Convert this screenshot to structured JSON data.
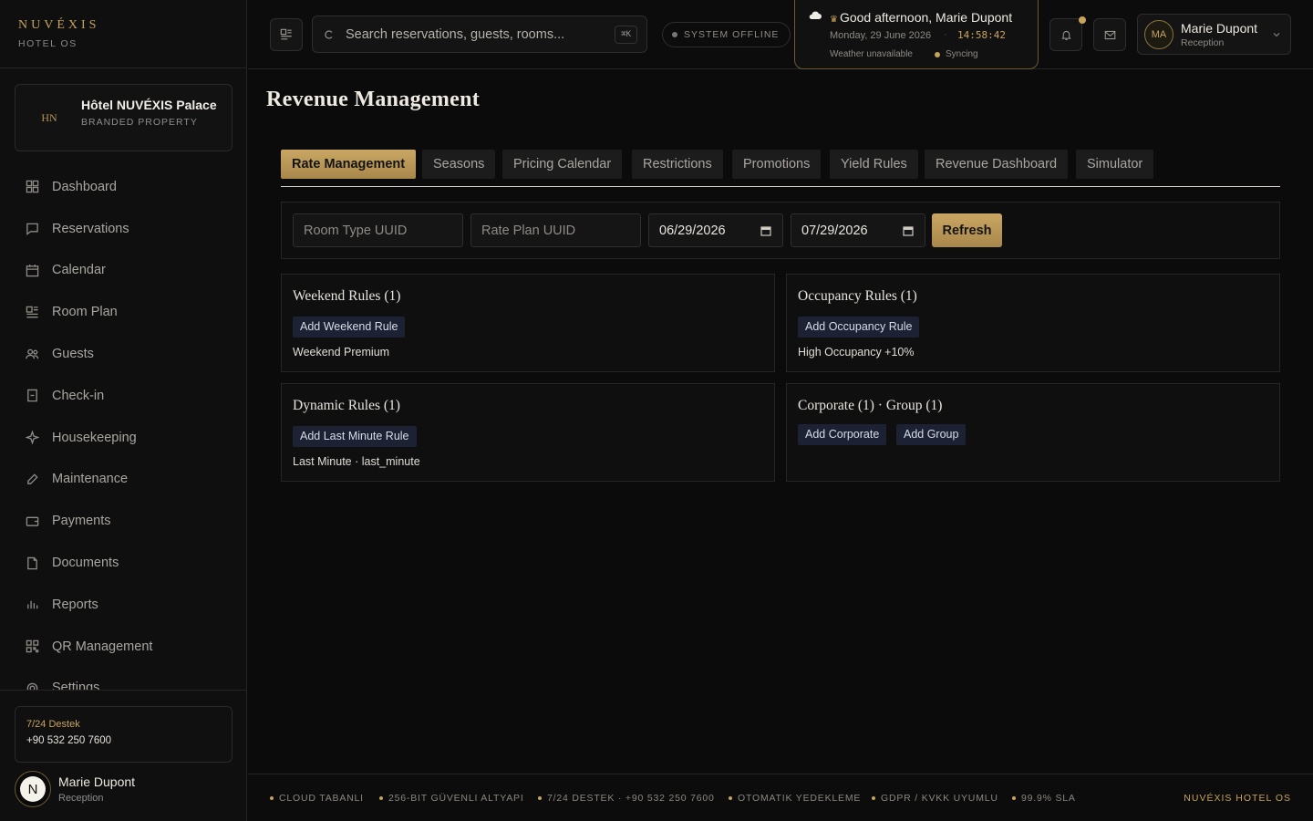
{
  "brand": {
    "name": "NUVÉXIS",
    "subtitle": "HOTEL OS"
  },
  "property": {
    "initials": "HN",
    "name": "Hôtel NUVÉXIS Palace",
    "type": "BRANDED PROPERTY"
  },
  "sidebar": {
    "items": [
      {
        "label": "Dashboard",
        "icon": "dashboard-icon"
      },
      {
        "label": "Reservations",
        "icon": "reservations-icon"
      },
      {
        "label": "Calendar",
        "icon": "calendar-icon"
      },
      {
        "label": "Room Plan",
        "icon": "room-plan-icon"
      },
      {
        "label": "Guests",
        "icon": "guests-icon"
      },
      {
        "label": "Check-in",
        "icon": "check-in-icon"
      },
      {
        "label": "Housekeeping",
        "icon": "sparkle-icon"
      },
      {
        "label": "Maintenance",
        "icon": "wrench-icon"
      },
      {
        "label": "Payments",
        "icon": "wallet-icon"
      },
      {
        "label": "Documents",
        "icon": "document-icon"
      },
      {
        "label": "Reports",
        "icon": "bar-chart-icon"
      },
      {
        "label": "QR Management",
        "icon": "qr-icon"
      },
      {
        "label": "Settings",
        "icon": "gear-icon"
      }
    ]
  },
  "support": {
    "title": "7/24 Destek",
    "phone": "+90 532 250 7600"
  },
  "side_user": {
    "initial": "N",
    "name": "Marie Dupont",
    "role": "Reception"
  },
  "topbar": {
    "search_placeholder": "Search reservations, guests, rooms...",
    "search_shortcut": "⌘K",
    "status": "SYSTEM OFFLINE",
    "greeting": "Good afternoon, Marie Dupont",
    "date": "Monday, 29 June 2026",
    "separator": "·",
    "time": "14:58:42",
    "weather": "Weather unavailable",
    "sync": "Syncing",
    "user": {
      "initials": "MA",
      "name": "Marie Dupont",
      "role": "Reception"
    }
  },
  "page": {
    "title": "Revenue Management"
  },
  "tabs": [
    {
      "label": "Rate Management",
      "active": true
    },
    {
      "label": "Seasons",
      "active": false
    },
    {
      "label": "Pricing Calendar",
      "active": false
    },
    {
      "label": "Restrictions",
      "active": false
    },
    {
      "label": "Promotions",
      "active": false
    },
    {
      "label": "Yield Rules",
      "active": false
    },
    {
      "label": "Revenue Dashboard",
      "active": false
    },
    {
      "label": "Simulator",
      "active": false
    }
  ],
  "filters": {
    "room_type_placeholder": "Room Type UUID",
    "rate_plan_placeholder": "Rate Plan UUID",
    "date_from": "06/29/2026",
    "date_to": "07/29/2026",
    "refresh_label": "Refresh"
  },
  "cards": {
    "weekend": {
      "title": "Weekend Rules (1)",
      "button": "Add Weekend Rule",
      "item": "Weekend Premium"
    },
    "occupancy": {
      "title": "Occupancy Rules (1)",
      "button": "Add Occupancy Rule",
      "item": "High Occupancy +10%"
    },
    "dynamic": {
      "title": "Dynamic Rules (1)",
      "button": "Add Last Minute Rule",
      "item": "Last Minute · last_minute"
    },
    "corporate": {
      "title": "Corporate (1) · Group (1)",
      "button_corporate": "Add Corporate",
      "button_group": "Add Group"
    }
  },
  "footer": {
    "items": [
      "CLOUD TABANLI",
      "256-BIT GÜVENLI ALTYAPI",
      "7/24 DESTEK · +90 532 250 7600",
      "OTOMATIK YEDEKLEME",
      "GDPR / KVKK UYUMLU",
      "99.9% SLA"
    ],
    "brand": "NUVÉXIS HOTEL OS"
  },
  "colors": {
    "accent": "#c8a35b",
    "background": "#0b0b0b",
    "chip": "#1c2233"
  }
}
